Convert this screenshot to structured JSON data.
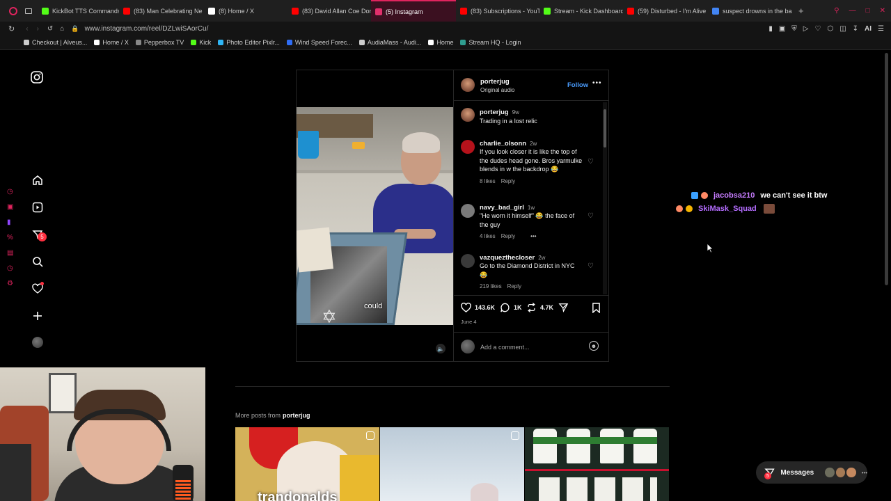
{
  "browser": {
    "tabs": [
      {
        "label": "KickBot TTS Commands",
        "color": "#53fc18"
      },
      {
        "label": "(83) Man Celebrating Ne",
        "color": "#ff0000"
      },
      {
        "label": "(8) Home / X",
        "color": "#ffffff"
      },
      {
        "label": "(83) David Allan Coe Don",
        "color": "#ff0000"
      },
      {
        "label": "(5) Instagram",
        "color": "#e1306c",
        "active": true
      },
      {
        "label": "(83) Subscriptions - YouT",
        "color": "#ff0000"
      },
      {
        "label": "Stream - Kick Dashboard",
        "color": "#53fc18"
      },
      {
        "label": "(59) Disturbed - I'm Alive",
        "color": "#ff0000"
      },
      {
        "label": "suspect drowns in the ba",
        "color": "#4285f4"
      }
    ],
    "url": "www.instagram.com/reel/DZLwiSAorCu/",
    "bookmarks": [
      "Checkout | Alveus...",
      "Home / X",
      "Pepperbox TV",
      "Kick",
      "Photo Editor Pixlr...",
      "Wind Speed Forec...",
      "AudiaMass - Audi...",
      "Home",
      "Stream HQ - Login"
    ]
  },
  "nav": {
    "notif_count": "5"
  },
  "post": {
    "author": "porterjug",
    "subtitle": "Original audio",
    "follow_label": "Follow",
    "caption_user": "porterjug",
    "caption_age": "9w",
    "caption_text": "Trading in a lost relic",
    "video_caption": "could",
    "comments": [
      {
        "user": "charlie_olsonn",
        "age": "2w",
        "text": "If you look closer it is like the top of the dudes head gone. Bros yarmulke blends in w the backdrop 😂",
        "likes": "8 likes",
        "reply": "Reply",
        "color": "#b5121b"
      },
      {
        "user": "navy_bad_girl",
        "age": "1w",
        "text": "\"He worn it himself\" 😂 the face of the guy",
        "likes": "4 likes",
        "reply": "Reply",
        "more": "•••",
        "color": "#7a7a7a"
      },
      {
        "user": "vazquezthecloser",
        "age": "2w",
        "text": "Go to the Diamond District in NYC 😂",
        "likes": "219 likes",
        "reply": "Reply",
        "color": "#3a3a3a"
      }
    ],
    "like_count": "143.6K",
    "comment_count": "1K",
    "repost_count": "4.7K",
    "date": "June 4",
    "add_comment_placeholder": "Add a comment..."
  },
  "more_posts": {
    "label": "More posts from",
    "user": "porterjug",
    "thumb1_caption": "trandonalds"
  },
  "chat": [
    {
      "user": "jacobsa210",
      "text": "we can't see it btw",
      "color": "#c77dff"
    },
    {
      "user": "SkiMask_Squad",
      "text": "",
      "color": "#b46cff"
    }
  ],
  "messages": {
    "label": "Messages",
    "badge": "5"
  }
}
